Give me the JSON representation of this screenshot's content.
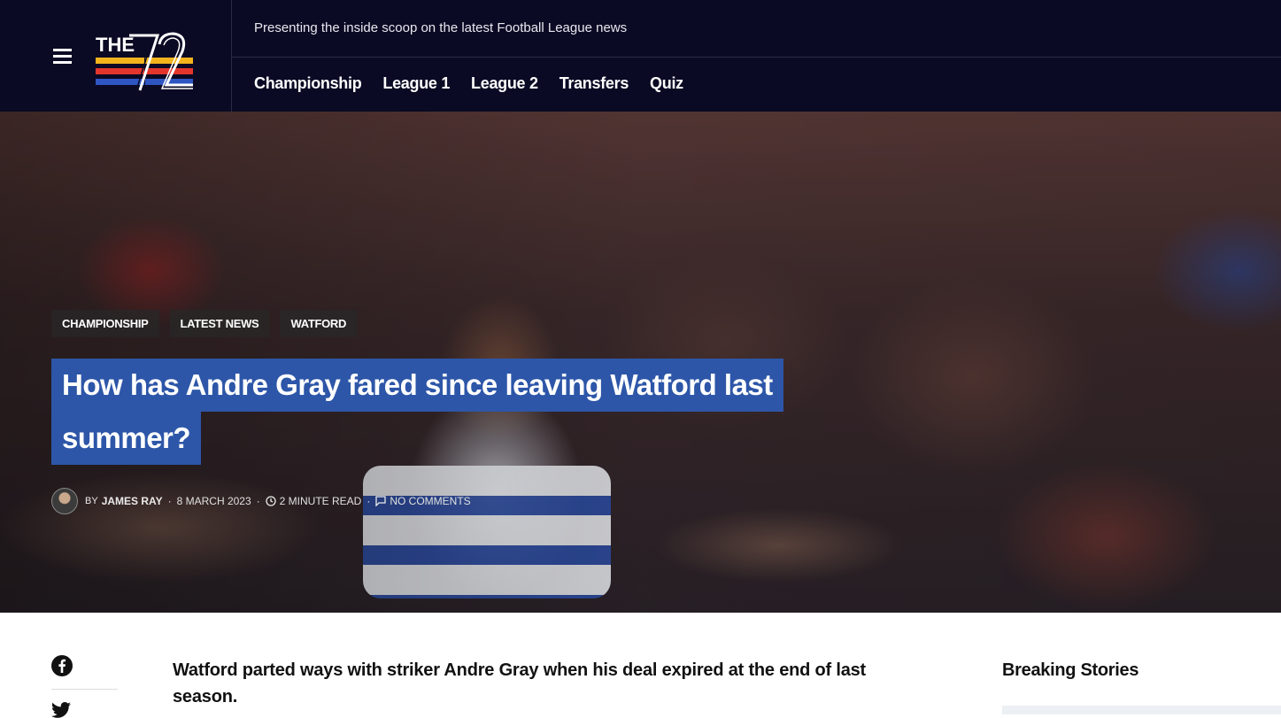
{
  "header": {
    "tagline": "Presenting the inside scoop on the latest Football League news",
    "logo_text": "THE 72",
    "nav": [
      "Championship",
      "League 1",
      "League 2",
      "Transfers",
      "Quiz"
    ]
  },
  "hero": {
    "tags": [
      "CHAMPIONSHIP",
      "LATEST NEWS",
      "WATFORD"
    ],
    "headline_line1": "How has Andre Gray fared since leaving Watford last",
    "headline_line2": "summer?",
    "meta": {
      "by": "BY",
      "author": "JAMES RAY",
      "date": "8 MARCH 2023",
      "read_time": "2 MINUTE READ",
      "comments": "NO COMMENTS"
    }
  },
  "article": {
    "lead": "Watford parted ways with striker Andre Gray when his deal expired at the end of last season."
  },
  "sidebar": {
    "heading": "Breaking Stories"
  },
  "colors": {
    "header_bg": "#0a0a24",
    "headline_bg": "#2d56a8",
    "logo_yellow": "#f2b31c",
    "logo_red": "#e3352b",
    "logo_blue": "#2f55c2"
  },
  "icons": [
    "menu-icon",
    "clock-icon",
    "comment-icon",
    "facebook-icon",
    "twitter-icon"
  ]
}
